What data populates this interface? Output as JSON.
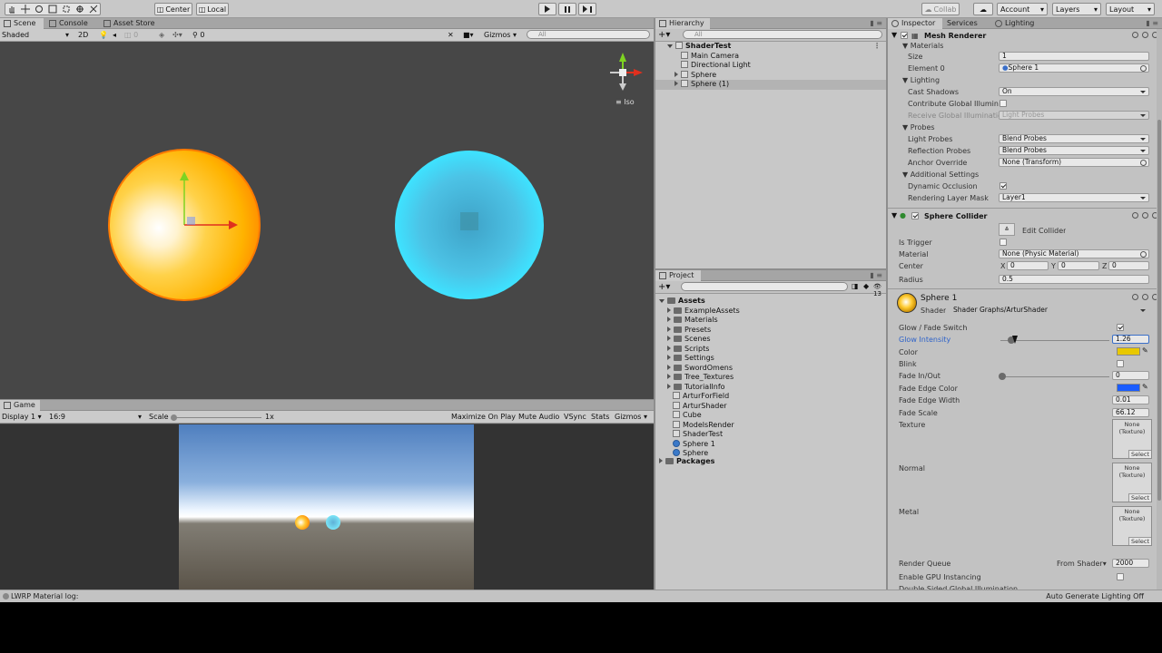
{
  "toolbar": {
    "pivot_label": "Center",
    "space_label": "Local",
    "collab_label": "Collab",
    "account_label": "Account",
    "layers_label": "Layers",
    "layout_label": "Layout"
  },
  "scene": {
    "tabs": [
      "Scene",
      "Console",
      "Asset Store"
    ],
    "draw_mode": "Shaded",
    "mode_2d": "2D",
    "hidden_count": "0",
    "gizmos_label": "Gizmos",
    "search_placeholder": "All",
    "iso_label": "Iso"
  },
  "game": {
    "tab": "Game",
    "display": "Display 1",
    "aspect": "16:9",
    "scale_label": "Scale",
    "scale_value": "1x",
    "maximize": "Maximize On Play",
    "mute": "Mute Audio",
    "vsync": "VSync",
    "stats": "Stats",
    "gizmos": "Gizmos"
  },
  "hierarchy": {
    "tab": "Hierarchy",
    "search_placeholder": "All",
    "scene_name": "ShaderTest",
    "items": [
      "Main Camera",
      "Directional Light",
      "Sphere",
      "Sphere (1)"
    ]
  },
  "project": {
    "tab": "Project",
    "count": "13",
    "root": "Assets",
    "folders": [
      "ExampleAssets",
      "Materials",
      "Presets",
      "Scenes",
      "Scripts",
      "Settings",
      "SwordOmens",
      "Tree_Textures",
      "TutorialInfo"
    ],
    "files": [
      "ArturForField",
      "ArturShader",
      "Cube",
      "ModelsRender",
      "ShaderTest",
      "Sphere 1",
      "Sphere"
    ],
    "packages": "Packages"
  },
  "inspector": {
    "tabs": [
      "Inspector",
      "Services",
      "Lighting"
    ],
    "mesh_renderer": {
      "title": "Mesh Renderer",
      "materials_label": "Materials",
      "size_label": "Size",
      "size_value": "1",
      "element0_label": "Element 0",
      "element0_value": "Sphere 1",
      "lighting_label": "Lighting",
      "cast_shadows_label": "Cast Shadows",
      "cast_shadows_value": "On",
      "contribute_gi_label": "Contribute Global Illumina",
      "receive_gi_label": "Receive Global Illuminatio",
      "receive_gi_value": "Light Probes",
      "probes_label": "Probes",
      "light_probes_label": "Light Probes",
      "light_probes_value": "Blend Probes",
      "reflection_probes_label": "Reflection Probes",
      "reflection_probes_value": "Blend Probes",
      "anchor_override_label": "Anchor Override",
      "anchor_override_value": "None (Transform)",
      "additional_label": "Additional Settings",
      "dynamic_occlusion_label": "Dynamic Occlusion",
      "rendering_layer_label": "Rendering Layer Mask",
      "rendering_layer_value": "Layer1"
    },
    "sphere_collider": {
      "title": "Sphere Collider",
      "edit_label": "Edit Collider",
      "is_trigger_label": "Is Trigger",
      "material_label": "Material",
      "material_value": "None (Physic Material)",
      "center_label": "Center",
      "center_x": "0",
      "center_y": "0",
      "center_z": "0",
      "radius_label": "Radius",
      "radius_value": "0.5"
    },
    "material": {
      "name": "Sphere 1",
      "shader_label": "Shader",
      "shader_value": "Shader Graphs/ArturShader",
      "glow_fade_label": "Glow / Fade Switch",
      "glow_intensity_label": "Glow Intensity",
      "glow_intensity_value": "1.26",
      "glow_intensity_fraction": 0.1,
      "color_label": "Color",
      "color_hex": "#e8c800",
      "blink_label": "Blink",
      "fade_inout_label": "Fade In/Out",
      "fade_inout_value": "0",
      "fade_edge_color_label": "Fade Edge Color",
      "fade_edge_color_hex": "#1a5cff",
      "fade_edge_width_label": "Fade Edge Width",
      "fade_edge_width_value": "0.01",
      "fade_scale_label": "Fade Scale",
      "fade_scale_value": "66.12",
      "texture_label": "Texture",
      "normal_label": "Normal",
      "metal_label": "Metal",
      "tex_none": "None",
      "tex_type": "(Texture)",
      "tex_select": "Select",
      "render_queue_label": "Render Queue",
      "render_queue_mode": "From Shader",
      "render_queue_value": "2000",
      "gpu_instancing_label": "Enable GPU Instancing",
      "double_sided_label": "Double Sided Global Illumination"
    }
  },
  "status": {
    "message": "LWRP Material log:",
    "right": "Auto Generate Lighting Off"
  }
}
